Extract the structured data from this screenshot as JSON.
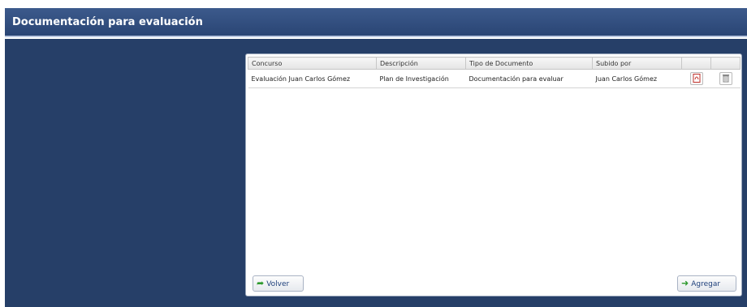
{
  "header": {
    "title": "Documentación para evaluación"
  },
  "table": {
    "columns": [
      "Concurso",
      "Descripción",
      "Tipo de Documento",
      "Subido por",
      "",
      ""
    ],
    "rows": [
      {
        "concurso": "Evaluación Juan Carlos Gómez",
        "descripcion": "Plan de Investigación",
        "tipo": "Documentación para evaluar",
        "subido_por": "Juan Carlos Gómez",
        "pdf_icon": "pdf-icon",
        "delete_icon": "trash-icon"
      }
    ]
  },
  "buttons": {
    "volver_label": "Volver",
    "agregar_label": "Agregar"
  },
  "colors": {
    "header_bg": "#2f4c7c",
    "panel_bg": "#263f68",
    "accent_green": "#2e9a2e"
  }
}
